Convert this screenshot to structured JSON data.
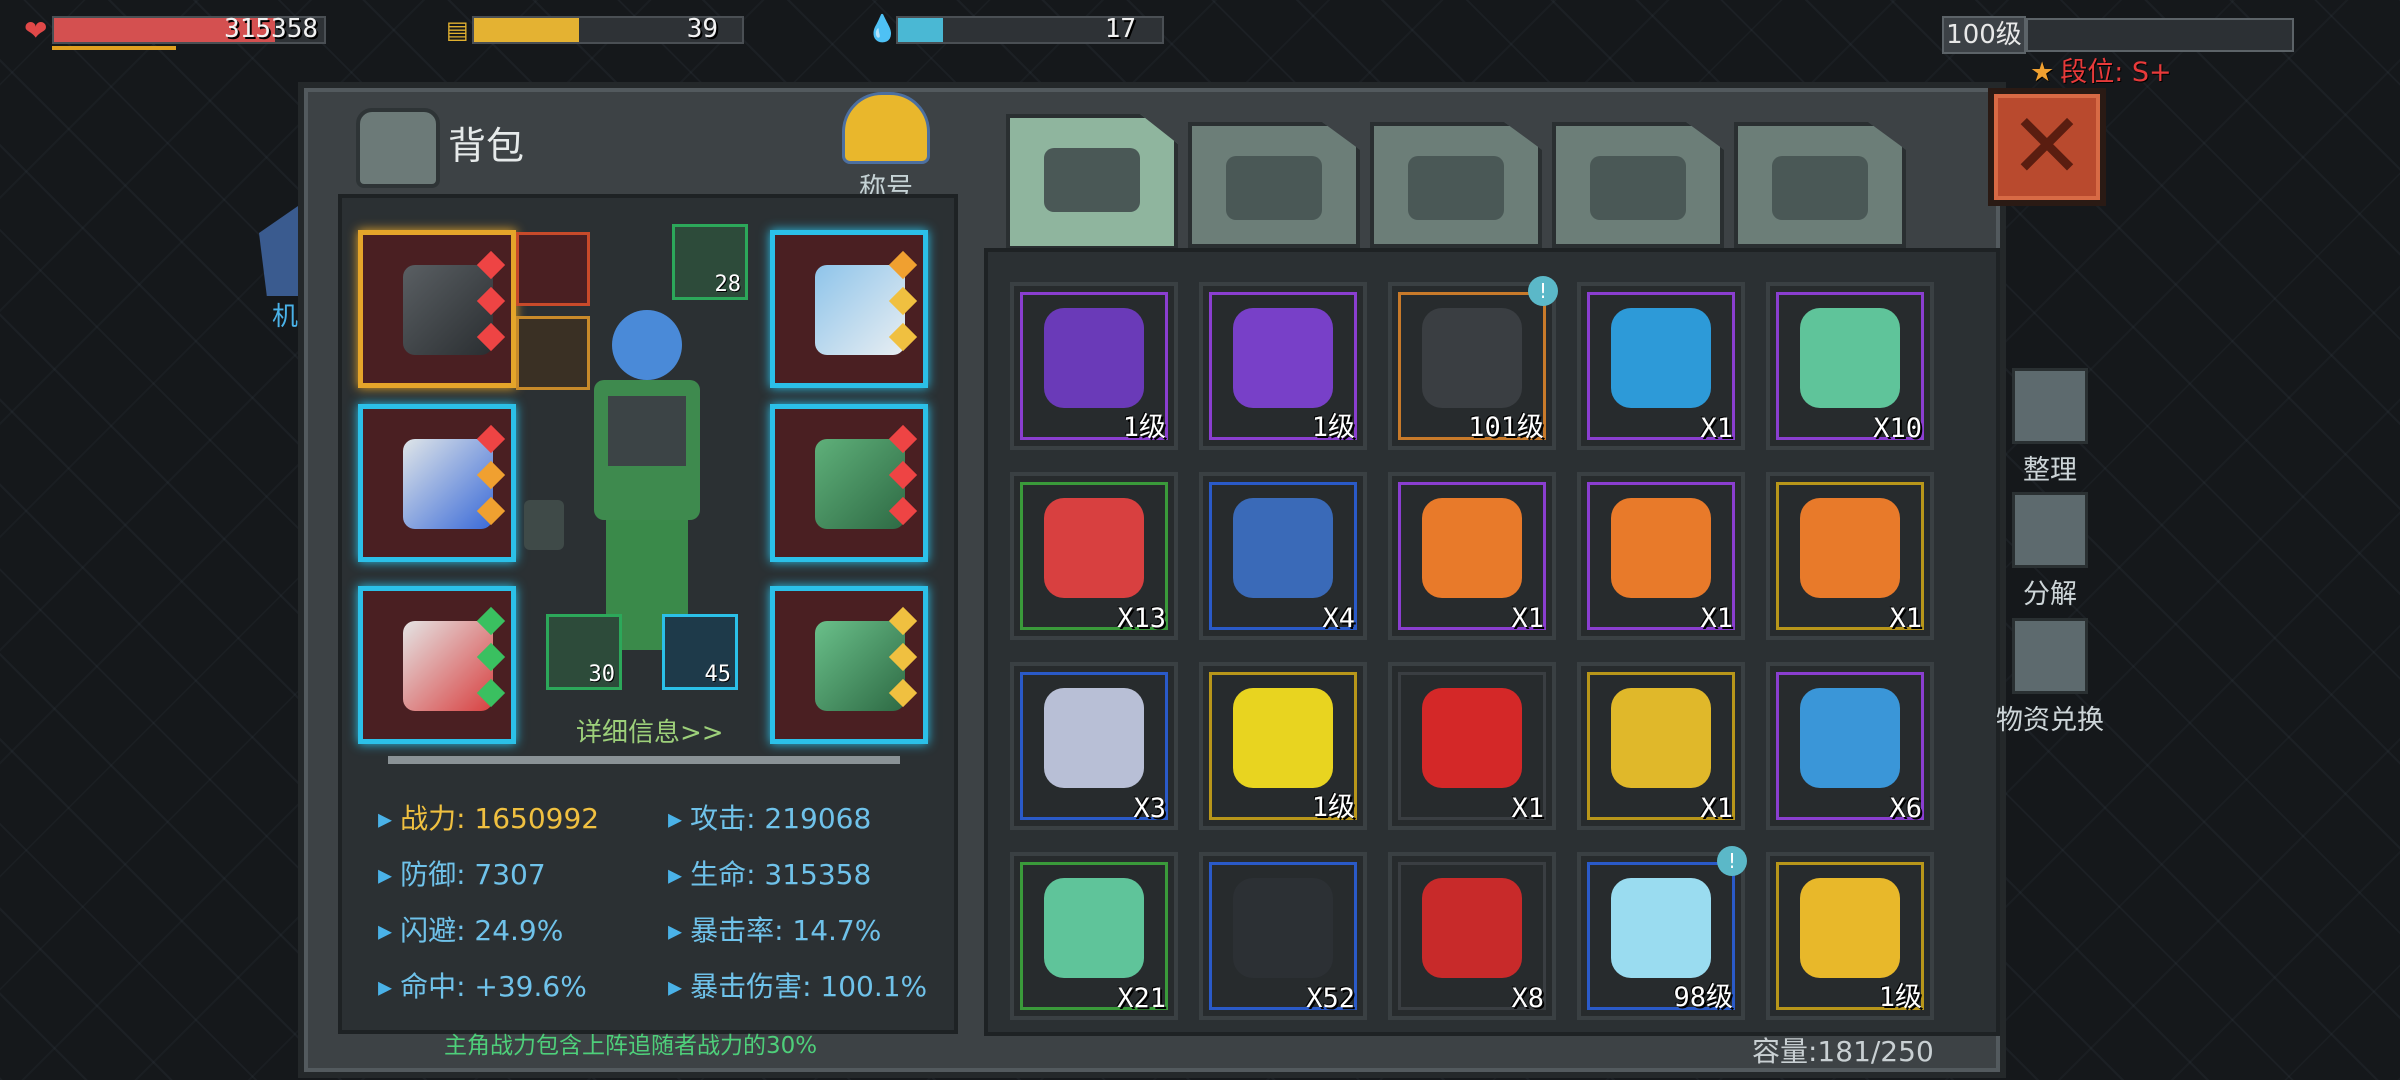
{
  "hud": {
    "hp_value": "315358",
    "hp_fill": 0.82,
    "energy_value": "39",
    "energy_fill": 0.39,
    "water_value": "17",
    "water_fill": 0.17,
    "level_label": "100级",
    "rank_label": "段位: S+"
  },
  "panel": {
    "title": "背包",
    "honor_label": "称号",
    "mech_label": "机甲",
    "detail_link": "详细信息>>",
    "note": "主角战力包含上阵追随者战力的30%",
    "capacity": "容量:181/250"
  },
  "equipment": {
    "mini_slots": [
      {
        "icon": "battery-icon",
        "count": "28"
      },
      {
        "icon": "core-icon",
        "count": "30"
      },
      {
        "icon": "chip-icon",
        "count": "45"
      }
    ]
  },
  "stats": [
    {
      "label": "战力: 1650992",
      "color": "gold"
    },
    {
      "label": "攻击: 219068",
      "color": "blue"
    },
    {
      "label": "防御: 7307",
      "color": "blue"
    },
    {
      "label": "生命: 315358",
      "color": "blue"
    },
    {
      "label": "闪避: 24.9%",
      "color": "blue"
    },
    {
      "label": "暴击率: 14.7%",
      "color": "blue"
    },
    {
      "label": "命中: +39.6%",
      "color": "blue"
    },
    {
      "label": "暴击伤害: 100.1%",
      "color": "blue"
    }
  ],
  "tabs": [
    {
      "icon": "backpack-icon",
      "active": true
    },
    {
      "icon": "medkit-icon",
      "active": false
    },
    {
      "icon": "materials-icon",
      "active": false
    },
    {
      "icon": "gun-icon",
      "active": false
    },
    {
      "icon": "wrench-icon",
      "active": false
    }
  ],
  "items": [
    {
      "icon": "fire-chip-icon",
      "count": "1级",
      "frame": "#8a3ed0",
      "color": "#6a3ab8"
    },
    {
      "icon": "target-chip-icon",
      "count": "1级",
      "frame": "#8a3ed0",
      "color": "#7840c8"
    },
    {
      "icon": "pistol-icon",
      "count": "101级",
      "frame": "#c87a2a",
      "color": "#3a3e42",
      "badge": "!"
    },
    {
      "icon": "blueprint-device-icon",
      "count": "X1",
      "frame": "#8a3ed0",
      "color": "#2d9ad8"
    },
    {
      "icon": "health-device-icon",
      "count": "X10",
      "frame": "#8a3ed0",
      "color": "#5fc49a"
    },
    {
      "icon": "weapon-device-icon",
      "count": "X13",
      "frame": "#3a9a3a",
      "color": "#d84040"
    },
    {
      "icon": "capsule-icon",
      "count": "X4",
      "frame": "#2a5ac8",
      "color": "#3a6ab8"
    },
    {
      "icon": "upgrade-chip-icon",
      "count": "X1",
      "frame": "#8a3ed0",
      "color": "#e87a2a"
    },
    {
      "icon": "upgrade-chip-icon",
      "count": "X1",
      "frame": "#8a3ed0",
      "color": "#e87a2a"
    },
    {
      "icon": "upgrade-chip-icon",
      "count": "X1",
      "frame": "#b8961a",
      "color": "#e87a2a"
    },
    {
      "icon": "metal-scrap-icon",
      "count": "X3",
      "frame": "#2a5ac8",
      "color": "#b8bfd6"
    },
    {
      "icon": "target-chip-gold-icon",
      "count": "1级",
      "frame": "#b8961a",
      "color": "#e8d420"
    },
    {
      "icon": "crystal-icon",
      "count": "X1",
      "frame": "#3a3e42",
      "color": "#d42828"
    },
    {
      "icon": "gold-crate-icon",
      "count": "X1",
      "frame": "#b8961a",
      "color": "#e0b82a"
    },
    {
      "icon": "tool-blueprint-icon",
      "count": "X6",
      "frame": "#8a3ed0",
      "color": "#3a96d8"
    },
    {
      "icon": "health-device-icon",
      "count": "X21",
      "frame": "#3a9a3a",
      "color": "#5fc49a"
    },
    {
      "icon": "microchip-icon",
      "count": "X52",
      "frame": "#2a5ac8",
      "color": "#2c3034"
    },
    {
      "icon": "apples-icon",
      "count": "X8",
      "frame": "#3a3e42",
      "color": "#c82a2a"
    },
    {
      "icon": "blade-icon",
      "count": "98级",
      "frame": "#2a5ac8",
      "color": "#9adcf0",
      "badge": "!"
    },
    {
      "icon": "fire-chip-gold-icon",
      "count": "1级",
      "frame": "#b8961a",
      "color": "#e8b82a"
    }
  ],
  "side_buttons": [
    {
      "icon": "sort-icon",
      "label": "整理"
    },
    {
      "icon": "dismantle-icon",
      "label": "分解"
    },
    {
      "icon": "exchange-icon",
      "label": "物资兑换"
    }
  ]
}
